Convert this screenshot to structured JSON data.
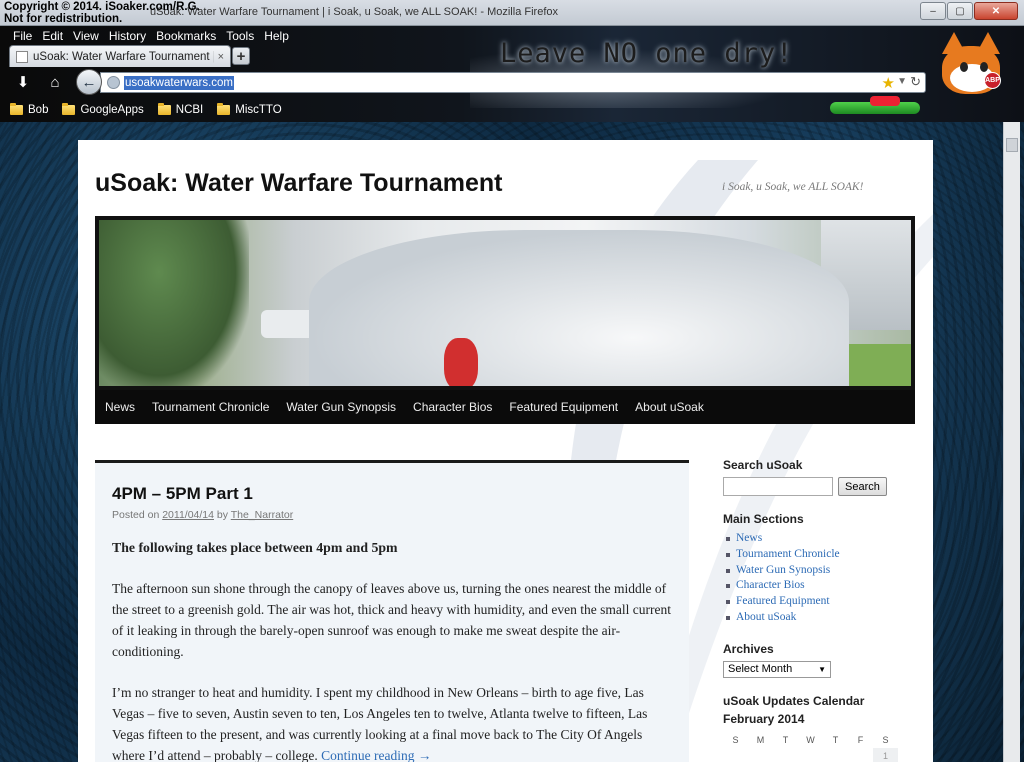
{
  "overlay": {
    "copyright_line1": "Copyright © 2014. iSoaker.com/R.G.",
    "copyright_line2": "Not for redistribution."
  },
  "window": {
    "title": "uSoak: Water Warfare Tournament | i Soak, u Soak, we ALL SOAK! - Mozilla Firefox",
    "controls": [
      "–",
      "▢",
      "✕"
    ]
  },
  "menubar": [
    {
      "label": "File"
    },
    {
      "label": "Edit"
    },
    {
      "label": "View"
    },
    {
      "label": "History"
    },
    {
      "label": "Bookmarks"
    },
    {
      "label": "Tools"
    },
    {
      "label": "Help"
    }
  ],
  "theme": {
    "banner_text": "Leave NO one dry!"
  },
  "tab": {
    "label": "uSoak: Water Warfare Tournament | i So...",
    "close": "×",
    "new_tab": "+"
  },
  "navbar": {
    "url": "usoakwaterwars.com",
    "abp_label": "ABP"
  },
  "bookmarks": [
    {
      "label": "Bob"
    },
    {
      "label": "GoogleApps"
    },
    {
      "label": "NCBI"
    },
    {
      "label": "MiscTTO"
    }
  ],
  "site": {
    "title": "uSoak: Water Warfare Tournament",
    "description": "i Soak, u Soak, we ALL SOAK!",
    "nav": [
      "News",
      "Tournament Chronicle",
      "Water Gun Synopsis",
      "Character Bios",
      "Featured Equipment",
      "About uSoak"
    ]
  },
  "article": {
    "title": "4PM – 5PM Part 1",
    "posted_on": "Posted on",
    "date": "2011/04/14",
    "by": "by",
    "author": "The_Narrator",
    "lead": "The following takes place between 4pm and 5pm",
    "p1": "The afternoon sun shone through the canopy of leaves above us, turning the ones nearest the middle of the street to a greenish gold.  The air was hot, thick and heavy with humidity, and even the small current of it leaking in through the barely-open sunroof was enough to make me sweat despite the air-conditioning.",
    "p2": "I’m no stranger to heat and humidity.  I spent my childhood in New Orleans – birth to age five, Las Vegas – five to seven, Austin seven to ten, Los Angeles ten to twelve, Atlanta twelve to fifteen, Las Vegas fifteen to the present, and was currently looking at a final move back to The City Of Angels where I’d attend – probably – college.",
    "continue": "Continue reading →"
  },
  "sidebar": {
    "search_title": "Search uSoak",
    "search_button": "Search",
    "sections_title": "Main Sections",
    "sections": [
      "News",
      "Tournament Chronicle",
      "Water Gun Synopsis",
      "Character Bios",
      "Featured Equipment",
      "About uSoak"
    ],
    "archives_title": "Archives",
    "archives_select": "Select Month",
    "calendar_title": "uSoak Updates Calendar",
    "calendar_month": "February 2014",
    "calendar_days": [
      "S",
      "M",
      "T",
      "W",
      "T",
      "F",
      "S"
    ],
    "calendar_first": "1"
  }
}
